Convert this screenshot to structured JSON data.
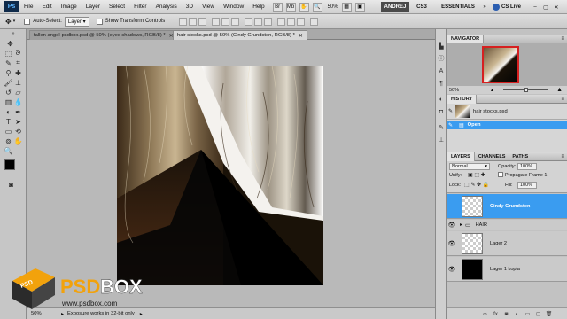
{
  "app": {
    "logo": "Ps",
    "menus": [
      "File",
      "Edit",
      "Image",
      "Layer",
      "Select",
      "Filter",
      "Analysis",
      "3D",
      "View",
      "Window",
      "Help"
    ],
    "mini_buttons": [
      "Br",
      "Mb"
    ],
    "zoom": "50%",
    "user": "ANDREJ",
    "version": "CS3",
    "workspace": "ESSENTIALS",
    "cs_live": "CS Live"
  },
  "options": {
    "auto_select_label": "Auto-Select:",
    "auto_select_value": "Layer",
    "transform_controls_label": "Show Transform Controls"
  },
  "tabs": [
    {
      "label": "fallen angel-psdbox.psd @ 50% (eyes shadows, RGB/8) *"
    },
    {
      "label": "hair stocks.psd @ 50% (Cindy Grundsten, RGB/8) *"
    }
  ],
  "status": {
    "zoom": "50%",
    "message": "Exposure works in 32-bit only"
  },
  "navigator": {
    "title": "NAVIGATOR",
    "zoom": "50%"
  },
  "history": {
    "title": "HISTORY",
    "snapshot": "hair stocks.psd",
    "steps": [
      "Open"
    ]
  },
  "layers_panel": {
    "tabs": [
      "LAYERS",
      "CHANNELS",
      "PATHS"
    ],
    "blend_mode": "Normal",
    "opacity_label": "Opacity:",
    "opacity": "100%",
    "unify_label": "Unify:",
    "propagate_label": "Propagate Frame 1",
    "lock_label": "Lock:",
    "fill_label": "Fill:",
    "fill": "100%",
    "layers": [
      {
        "name": "Cindy Grundsten",
        "selected": true
      },
      {
        "name": "HAIR",
        "group": true
      },
      {
        "name": "Lager 2"
      },
      {
        "name": "Lager 1 kopia"
      }
    ]
  },
  "watermark": {
    "brand_left": "PSD",
    "brand_right": "BOX",
    "url": "www.psdbox.com"
  },
  "colors": {
    "selection": "#3a9cf0",
    "ps_blue": "#2a5db0",
    "watermark_orange": "#f2a20c"
  }
}
